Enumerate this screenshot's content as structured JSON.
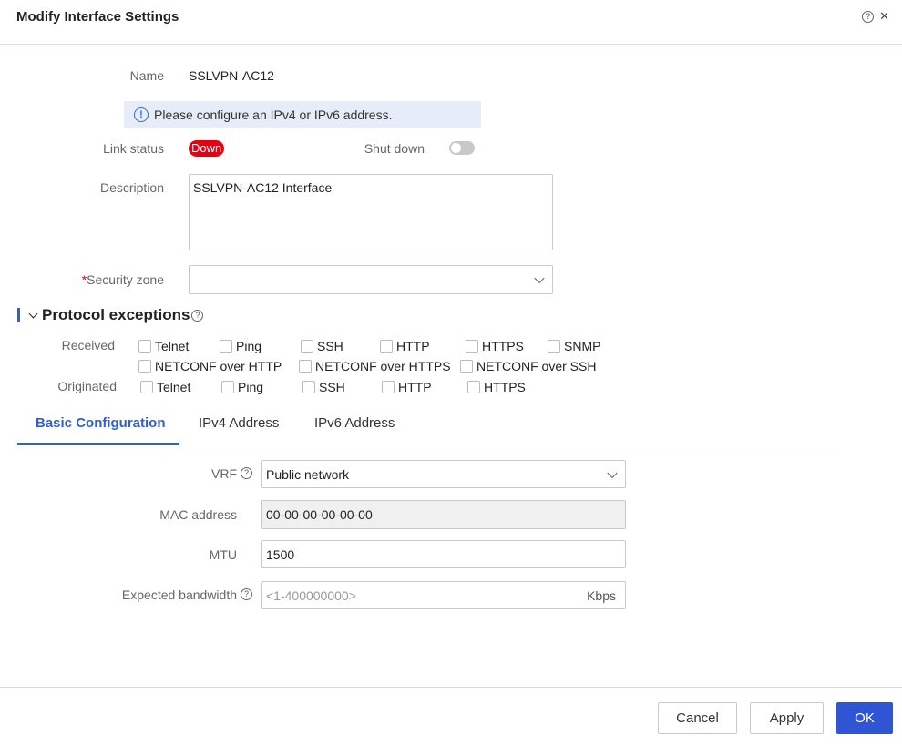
{
  "dialog": {
    "title": "Modify Interface Settings",
    "help_glyph": "?",
    "close_glyph": "✕"
  },
  "form": {
    "name_label": "Name",
    "name_value": "SSLVPN-AC12",
    "info_message": "Please configure an IPv4 or IPv6 address.",
    "link_status_label": "Link status",
    "link_status_value": "Down",
    "shutdown_label": "Shut down",
    "shutdown_on": false,
    "description_label": "Description",
    "description_value": "SSLVPN-AC12 Interface",
    "security_zone_required": "*",
    "security_zone_label": "Security zone",
    "security_zone_value": ""
  },
  "protocol_exceptions": {
    "title": "Protocol exceptions",
    "received_label": "Received",
    "received_row1": [
      "Telnet",
      "Ping",
      "SSH",
      "HTTP",
      "HTTPS",
      "SNMP"
    ],
    "received_row2": [
      "NETCONF over HTTP",
      "NETCONF over HTTPS",
      "NETCONF over SSH"
    ],
    "originated_label": "Originated",
    "originated": [
      "Telnet",
      "Ping",
      "SSH",
      "HTTP",
      "HTTPS"
    ]
  },
  "tabs": [
    "Basic Configuration",
    "IPv4 Address",
    "IPv6 Address"
  ],
  "basic": {
    "vrf_label": "VRF",
    "vrf_value": "Public network",
    "mac_label": "MAC address",
    "mac_value": "00-00-00-00-00-00",
    "mtu_label": "MTU",
    "mtu_value": "1500",
    "bandwidth_label": "Expected bandwidth",
    "bandwidth_placeholder": "<1-400000000>",
    "bandwidth_unit": "Kbps"
  },
  "footer": {
    "cancel": "Cancel",
    "apply": "Apply",
    "ok": "OK"
  },
  "colors": {
    "accent": "#2f55d4",
    "down_badge": "#e60012",
    "info_bg": "#e6ecf8"
  }
}
